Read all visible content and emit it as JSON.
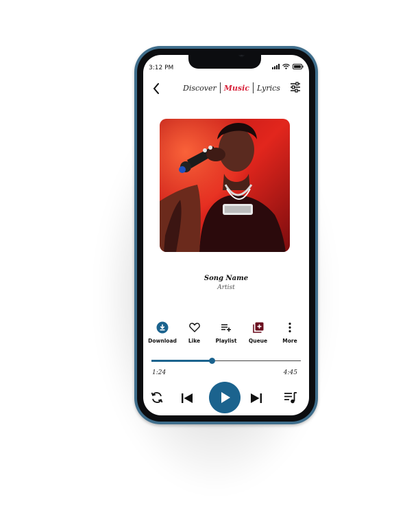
{
  "status": {
    "time": "3:12 PM"
  },
  "nav": {
    "back_icon": "chevron-left-icon",
    "tabs": [
      {
        "label": "Discover"
      },
      {
        "label": "Music"
      },
      {
        "label": "Lyrics"
      }
    ],
    "active_tab": "Music",
    "settings_icon": "sliders-icon"
  },
  "track": {
    "title": "Song Name",
    "artist": "Artist"
  },
  "actions": [
    {
      "label": "Download",
      "icon": "download-circle-icon"
    },
    {
      "label": "Like",
      "icon": "heart-icon"
    },
    {
      "label": "Playlist",
      "icon": "playlist-add-icon"
    },
    {
      "label": "Queue",
      "icon": "queue-add-icon"
    },
    {
      "label": "More",
      "icon": "more-vertical-icon"
    }
  ],
  "playback": {
    "current_time": "1:24",
    "total_time": "4:45",
    "progress": 0.405
  },
  "colors": {
    "accent": "#1b638e",
    "active_tab": "#d8233b",
    "frame": "#3f6e8c"
  }
}
